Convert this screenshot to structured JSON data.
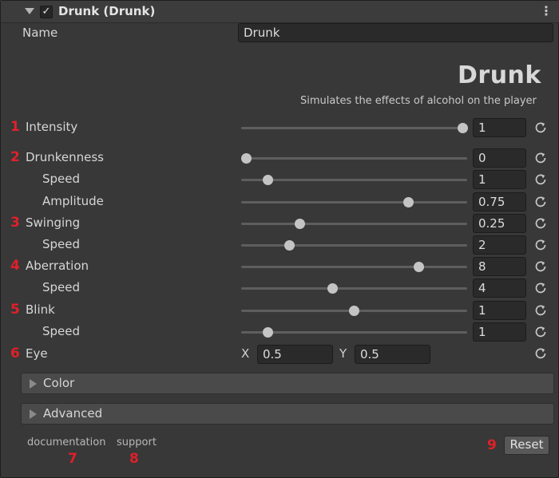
{
  "header": {
    "title": "Drunk (Drunk)",
    "enabled_check": "✓",
    "kebab": "⋮"
  },
  "name": {
    "label": "Name",
    "value": "Drunk"
  },
  "logo": {
    "text": "Drunk",
    "subtitle": "Simulates the effects of alcohol on the player"
  },
  "params": [
    {
      "badge": "1",
      "label": "Intensity",
      "value": "1",
      "level": 1.0
    },
    {
      "badge": "2",
      "label": "Drunkenness",
      "value": "0",
      "level": 0.0
    },
    {
      "badge": "",
      "label": "Speed",
      "value": "1",
      "level": 0.1
    },
    {
      "badge": "",
      "label": "Amplitude",
      "value": "0.75",
      "level": 0.75
    },
    {
      "badge": "3",
      "label": "Swinging",
      "value": "0.25",
      "level": 0.25
    },
    {
      "badge": "",
      "label": "Speed",
      "value": "2",
      "level": 0.2
    },
    {
      "badge": "4",
      "label": "Aberration",
      "value": "8",
      "level": 0.8
    },
    {
      "badge": "",
      "label": "Speed",
      "value": "4",
      "level": 0.4
    },
    {
      "badge": "5",
      "label": "Blink",
      "value": "1",
      "level": 0.5
    },
    {
      "badge": "",
      "label": "Speed",
      "value": "1",
      "level": 0.1
    }
  ],
  "eye": {
    "badge": "6",
    "label": "Eye",
    "x_label": "X",
    "x_value": "0.5",
    "y_label": "Y",
    "y_value": "0.5"
  },
  "foldouts": {
    "color": "Color",
    "advanced": "Advanced"
  },
  "footer": {
    "documentation": "documentation",
    "documentation_badge": "7",
    "support": "support",
    "support_badge": "8",
    "reset_badge": "9",
    "reset_label": "Reset"
  },
  "colors": {
    "background": "#383838",
    "field": "#2a2a2a",
    "badge": "#e0202a",
    "thumb": "#c4c4c4"
  },
  "icons": {
    "reset": "refresh-icon",
    "foldout": "triangle-right-icon",
    "header_fold": "triangle-down-icon"
  }
}
